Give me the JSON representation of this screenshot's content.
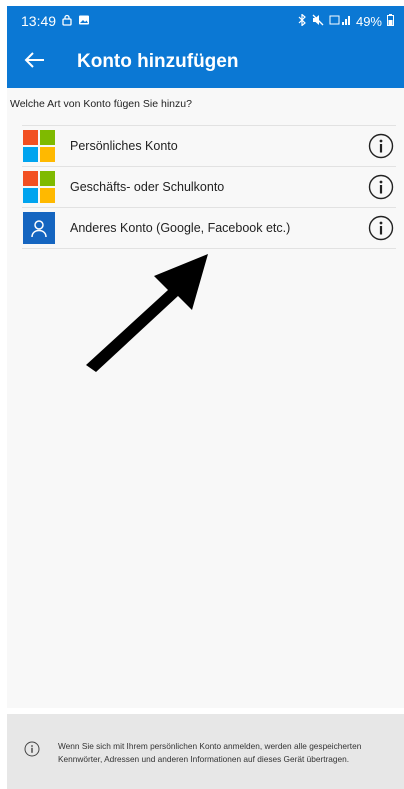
{
  "status_bar": {
    "time": "13:49",
    "signal_text": "📶",
    "battery": "49%"
  },
  "toolbar": {
    "title": "Konto hinzufügen",
    "back_icon": "arrow-left-icon"
  },
  "prompt": "Welche Art von Konto fügen Sie hinzu?",
  "accounts": [
    {
      "label": "Persönliches Konto",
      "icon": "microsoft-logo-icon"
    },
    {
      "label": "Geschäfts- oder Schulkonto",
      "icon": "microsoft-logo-icon"
    },
    {
      "label": "Anderes Konto (Google, Facebook etc.)",
      "icon": "person-icon"
    }
  ],
  "footer": {
    "text": "Wenn Sie sich mit Ihrem persönlichen Konto anmelden, werden alle gespeicherten Kennwörter, Adressen und anderen Informationen auf dieses Gerät übertragen."
  },
  "colors": {
    "accent": "#0b78d4",
    "ms_red": "#f25022",
    "ms_green": "#7fba00",
    "ms_blue": "#00a4ef",
    "ms_yellow": "#ffb900",
    "person_blue": "#1565c0"
  }
}
